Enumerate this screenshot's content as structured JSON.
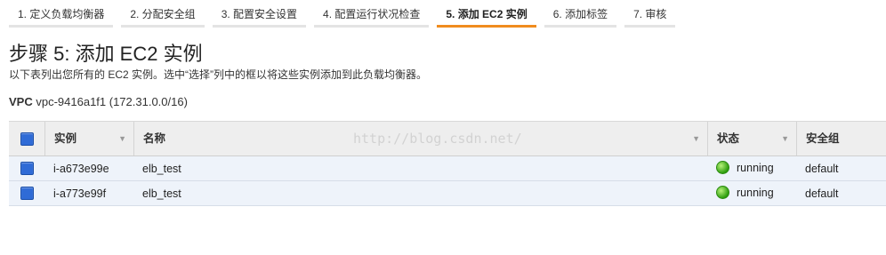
{
  "wizard": {
    "steps": [
      {
        "label": "1. 定义负载均衡器"
      },
      {
        "label": "2. 分配安全组"
      },
      {
        "label": "3. 配置安全设置"
      },
      {
        "label": "4. 配置运行状况检查"
      },
      {
        "label": "5. 添加 EC2 实例"
      },
      {
        "label": "6. 添加标签"
      },
      {
        "label": "7. 审核"
      }
    ],
    "active_color": "#f08c1e"
  },
  "page": {
    "title": "步骤 5: 添加 EC2 实例",
    "description": "以下表列出您所有的 EC2 实例。选中“选择”列中的框以将这些实例添加到此负载均衡器。"
  },
  "vpc": {
    "label": "VPC",
    "value": "vpc-9416a1f1 (172.31.0.0/16)"
  },
  "watermark": "http://blog.csdn.net/",
  "table": {
    "headers": {
      "instance": "实例",
      "name": "名称",
      "status": "状态",
      "security_group": "安全组"
    },
    "rows": [
      {
        "instance": "i-a673e99e",
        "name": "elb_test",
        "status": "running",
        "security_group": "default",
        "selected": true
      },
      {
        "instance": "i-a773e99f",
        "name": "elb_test",
        "status": "running",
        "security_group": "default",
        "selected": true
      }
    ],
    "running_color": "#2e9e0e",
    "checkbox_color": "#2f6bd6"
  }
}
